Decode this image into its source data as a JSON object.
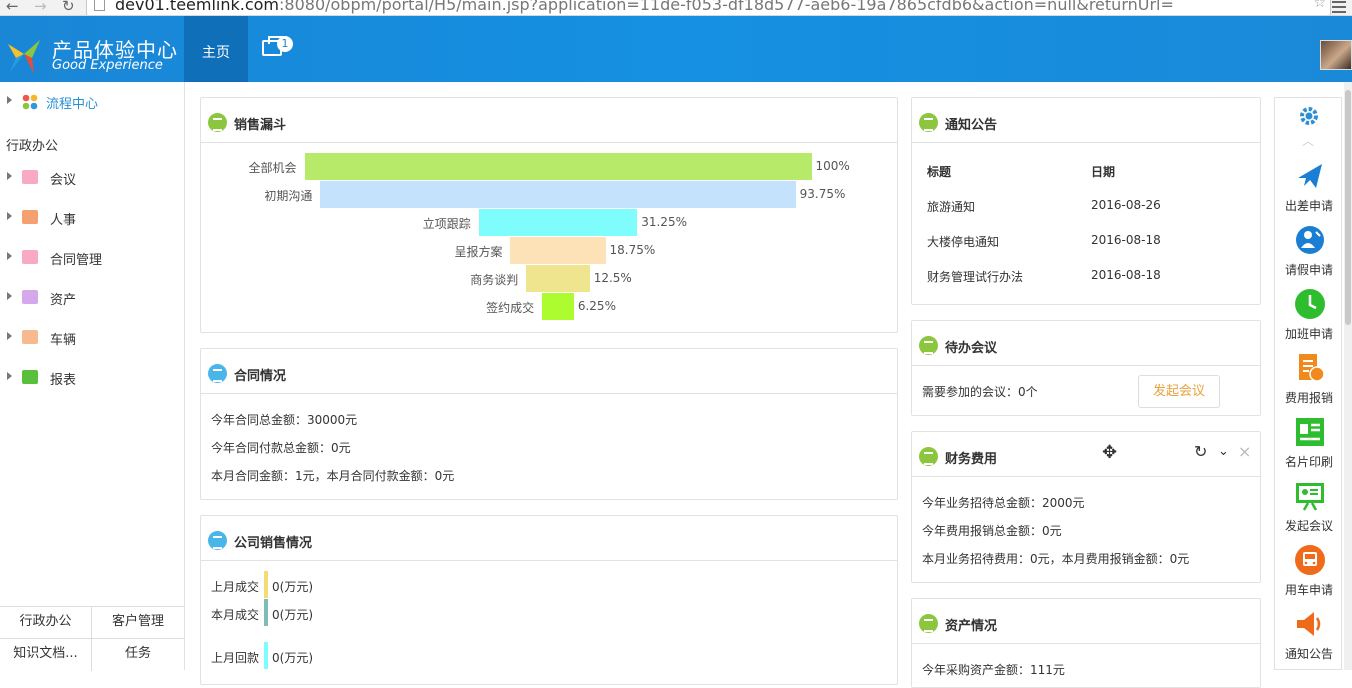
{
  "browser": {
    "url_host": "dev01.teemlink.com",
    "url_rest": ":8080/obpm/portal/H5/main.jsp?application=11de-f053-df18d577-aeb6-19a7865cfdb6&action=null&returnUrl="
  },
  "header": {
    "logo_cn": "产品体验中心",
    "logo_en": "Good Experience",
    "tab_home": "主页",
    "msg_count": "1"
  },
  "sidebar": {
    "flow": "流程中心",
    "section": "行政办公",
    "items": [
      {
        "label": "会议",
        "color": "#f07aa8"
      },
      {
        "label": "人事",
        "color": "#f0874b"
      },
      {
        "label": "合同管理",
        "color": "#f07aa8"
      },
      {
        "label": "资产",
        "color": "#c58be0"
      },
      {
        "label": "车辆",
        "color": "#f4a06b"
      },
      {
        "label": "报表",
        "color": "#58c03b"
      }
    ],
    "bottom": [
      [
        "行政办公",
        "客户管理"
      ],
      [
        "知识文档...",
        "任务"
      ]
    ]
  },
  "funnel": {
    "title": "销售漏斗",
    "stages": [
      {
        "label": "全部机会",
        "value": "100%",
        "pct": 100,
        "color": "#b8ea6a"
      },
      {
        "label": "初期沟通",
        "value": "93.75%",
        "pct": 93.75,
        "color": "#c4e2fb"
      },
      {
        "label": "立项跟踪",
        "value": "31.25%",
        "pct": 31.25,
        "color": "#7ffdfd"
      },
      {
        "label": "呈报方案",
        "value": "18.75%",
        "pct": 18.75,
        "color": "#fde2b8"
      },
      {
        "label": "商务谈判",
        "value": "12.5%",
        "pct": 12.5,
        "color": "#f0e58f"
      },
      {
        "label": "签约成交",
        "value": "6.25%",
        "pct": 6.25,
        "color": "#adfc2f"
      }
    ]
  },
  "contract": {
    "title": "合同情况",
    "lines": [
      "今年合同总金额：30000元",
      "今年合同付款总金额：0元",
      "本月合同金额：1元，本月合同付款金额：0元"
    ]
  },
  "sales": {
    "title": "公司销售情况",
    "rows": [
      {
        "label": "上月成交",
        "value": "0(万元)",
        "color": "#f3dc74"
      },
      {
        "label": "本月成交",
        "value": "0(万元)",
        "color": "#7fbcb5"
      },
      {
        "label": "上月回款",
        "value": "0(万元)",
        "color": "#7ffdfd"
      }
    ]
  },
  "notice": {
    "title": "通知公告",
    "col_title": "标题",
    "col_date": "日期",
    "rows": [
      {
        "title": "旅游通知",
        "date": "2016-08-26"
      },
      {
        "title": "大楼停电通知",
        "date": "2016-08-18"
      },
      {
        "title": "财务管理试行办法",
        "date": "2016-08-18"
      }
    ]
  },
  "meeting": {
    "title": "待办会议",
    "text": "需要参加的会议：0个",
    "button": "发起会议"
  },
  "finance": {
    "title": "财务费用",
    "lines": [
      "今年业务招待总金额：2000元",
      "今年费用报销总金额：0元",
      "本月业务招待费用：0元，本月费用报销金额：0元"
    ]
  },
  "assets": {
    "title": "资产情况",
    "line": "今年采购资产金额：111元"
  },
  "quick": [
    {
      "label": "出差申请",
      "icon": "plane-icon",
      "color": "#1a7fd4"
    },
    {
      "label": "请假申请",
      "icon": "user-leave-icon",
      "color": "#1a7fd4"
    },
    {
      "label": "加班申请",
      "icon": "clock-icon",
      "color": "#2fbd30"
    },
    {
      "label": "费用报销",
      "icon": "expense-icon",
      "color": "#f08a1c"
    },
    {
      "label": "名片印刷",
      "icon": "card-icon",
      "color": "#2fbd30"
    },
    {
      "label": "发起会议",
      "icon": "meeting-icon",
      "color": "#2fbd30"
    },
    {
      "label": "用车申请",
      "icon": "bus-icon",
      "color": "#f06a1c"
    },
    {
      "label": "通知公告",
      "icon": "speaker-icon",
      "color": "#f06a1c"
    }
  ]
}
